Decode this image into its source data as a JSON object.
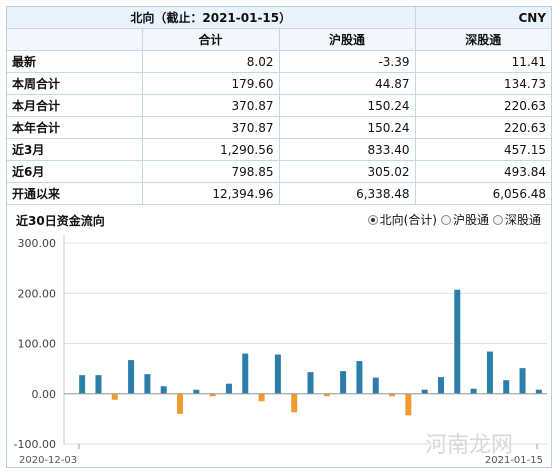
{
  "table": {
    "title": "北向（截止：2021-01-15）",
    "currency": "CNY",
    "columns": [
      "合计",
      "沪股通",
      "深股通"
    ],
    "rows": [
      {
        "label": "最新",
        "values": [
          "8.02",
          "-3.39",
          "11.41"
        ]
      },
      {
        "label": "本周合计",
        "values": [
          "179.60",
          "44.87",
          "134.73"
        ]
      },
      {
        "label": "本月合计",
        "values": [
          "370.87",
          "150.24",
          "220.63"
        ]
      },
      {
        "label": "本年合计",
        "values": [
          "370.87",
          "150.24",
          "220.63"
        ]
      },
      {
        "label": "近3月",
        "values": [
          "1,290.56",
          "833.40",
          "457.15"
        ]
      },
      {
        "label": "近6月",
        "values": [
          "798.85",
          "305.02",
          "493.84"
        ]
      },
      {
        "label": "开通以来",
        "values": [
          "12,394.96",
          "6,338.48",
          "6,056.48"
        ]
      }
    ]
  },
  "chart_header": {
    "title": "近30日资金流向",
    "options": [
      {
        "label": "北向(合计)",
        "selected": true
      },
      {
        "label": "沪股通",
        "selected": false
      },
      {
        "label": "深股通",
        "selected": false
      }
    ]
  },
  "watermark": "河南龙网",
  "chart_data": {
    "type": "bar",
    "title": "近30日资金流向",
    "xlabel": "",
    "ylabel": "",
    "ylim": [
      -100,
      300
    ],
    "yticks": [
      "300.00",
      "200.00",
      "100.00",
      "0.00",
      "-100.00"
    ],
    "x_range_labels": [
      "2020-12-03",
      "2021-01-15"
    ],
    "grid": true,
    "colors": {
      "positive": "#2b7ea8",
      "negative": "#f19a30"
    },
    "values": [
      37,
      37,
      -12,
      67,
      39,
      15,
      -40,
      8,
      -5,
      20,
      80,
      -15,
      78,
      -37,
      43,
      -5,
      45,
      65,
      32,
      -5,
      -43,
      8,
      33,
      207,
      10,
      84,
      27,
      51,
      8
    ]
  }
}
